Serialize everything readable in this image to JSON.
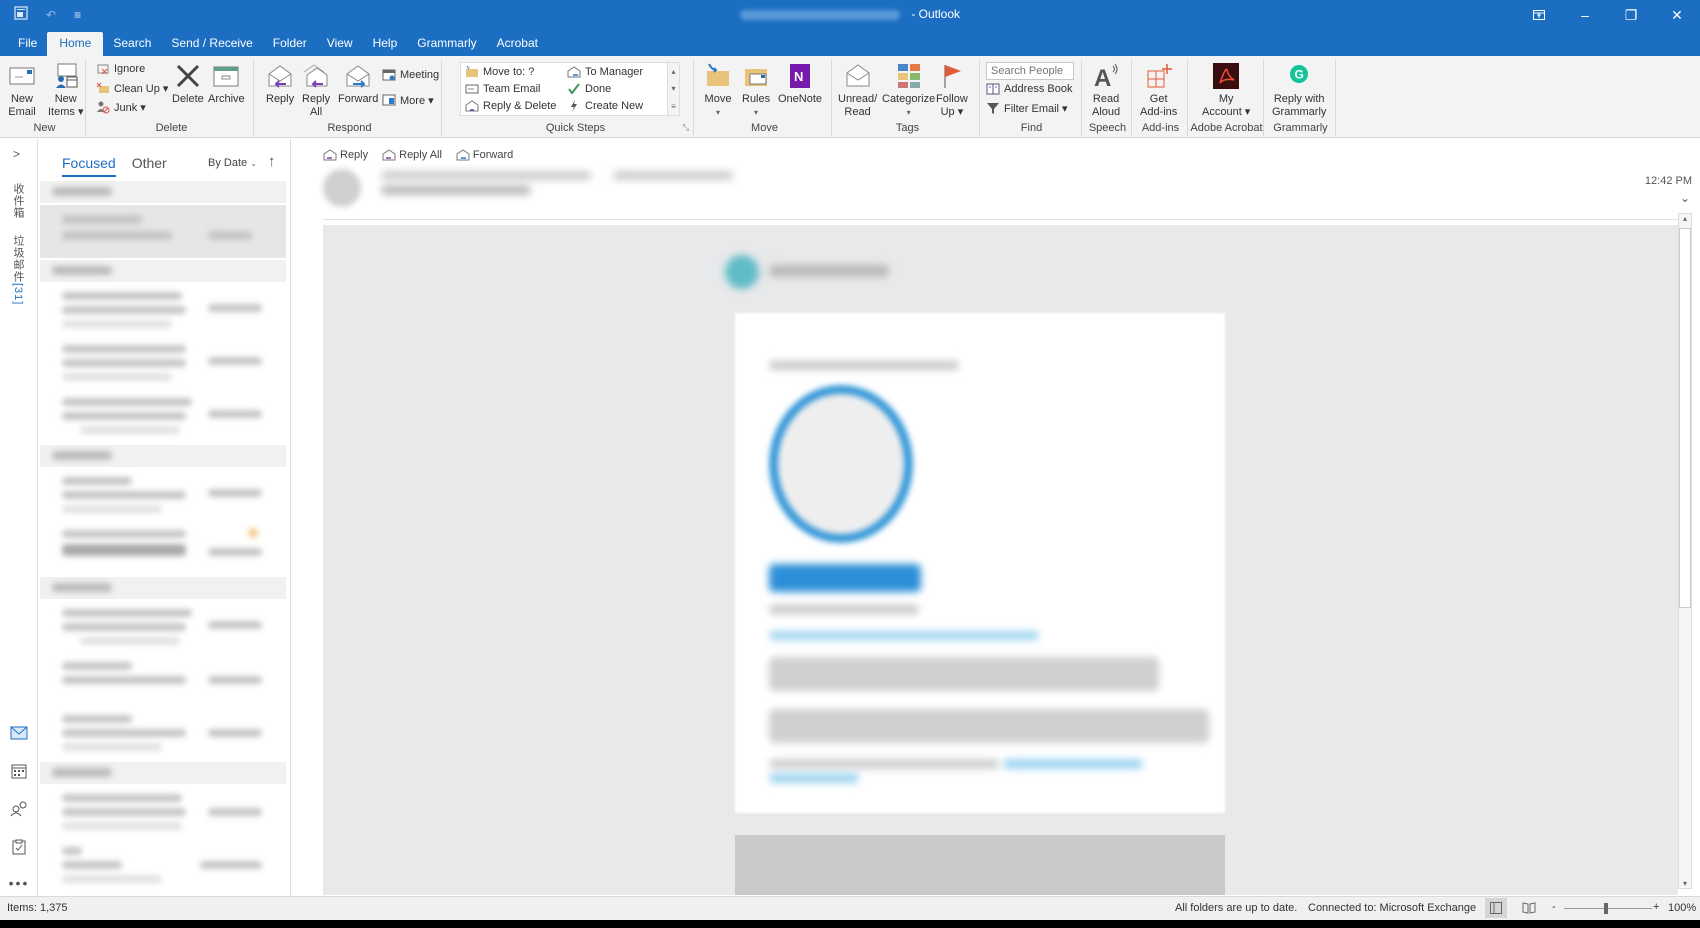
{
  "window": {
    "app_title": "Outlook",
    "title_separator": "-",
    "controls": {
      "ribbon_display": "ribbon-display-icon",
      "minimize": "–",
      "restore": "❐",
      "close": "✕"
    }
  },
  "quick_access": {
    "save_icon": "outlook-icon",
    "undo_icon": "undo-icon",
    "customize_icon": "customize-icon"
  },
  "tabs": [
    {
      "label": "File"
    },
    {
      "label": "Home",
      "active": true
    },
    {
      "label": "Search"
    },
    {
      "label": "Send / Receive"
    },
    {
      "label": "Folder"
    },
    {
      "label": "View"
    },
    {
      "label": "Help"
    },
    {
      "label": "Grammarly"
    },
    {
      "label": "Acrobat"
    }
  ],
  "ribbon": {
    "new": {
      "label": "New",
      "new_email": "New\nEmail",
      "new_email_l1": "New",
      "new_email_l2": "Email",
      "new_items_l1": "New",
      "new_items_l2": "Items ▾"
    },
    "delete": {
      "label": "Delete",
      "ignore": "Ignore",
      "clean_up": "Clean Up ▾",
      "junk": "Junk ▾",
      "delete": "Delete",
      "archive": "Archive"
    },
    "respond": {
      "label": "Respond",
      "reply": "Reply",
      "reply_all_l1": "Reply",
      "reply_all_l2": "All",
      "forward": "Forward",
      "meeting": "Meeting",
      "more": "More ▾"
    },
    "quick_steps": {
      "label": "Quick Steps",
      "items": [
        "Move to: ?",
        "Team Email",
        "Reply & Delete",
        "To Manager",
        "Done",
        "Create New"
      ]
    },
    "move": {
      "label": "Move",
      "move": "Move",
      "rules": "Rules",
      "onenote": "OneNote"
    },
    "tags": {
      "label": "Tags",
      "unread_l1": "Unread/",
      "unread_l2": "Read",
      "categorize": "Categorize",
      "follow_l1": "Follow",
      "follow_l2": "Up ▾"
    },
    "find": {
      "label": "Find",
      "search_people_placeholder": "Search People",
      "address_book": "Address Book",
      "filter_email": "Filter Email ▾"
    },
    "speech": {
      "label": "Speech",
      "read_l1": "Read",
      "read_l2": "Aloud"
    },
    "addins": {
      "label": "Add-ins",
      "get_l1": "Get",
      "get_l2": "Add-ins"
    },
    "acrobat": {
      "label": "Adobe Acrobat",
      "my_l1": "My",
      "my_l2": "Account ▾"
    },
    "grammarly": {
      "label": "Grammarly",
      "reply_l1": "Reply with",
      "reply_l2": "Grammarly"
    }
  },
  "folder_pane": {
    "expand_icon": ">",
    "inbox_label": "收件箱",
    "junk_label": "垃圾邮件",
    "junk_count": "[31]",
    "nav": [
      "mail-icon",
      "calendar-icon",
      "people-icon",
      "tasks-icon",
      "more-icon"
    ]
  },
  "message_list": {
    "tabs": [
      {
        "label": "Focused",
        "active": true
      },
      {
        "label": "Other"
      }
    ],
    "sort_label": "By Date",
    "sort_direction": "↑"
  },
  "reading_pane": {
    "actions": {
      "reply": "Reply",
      "reply_all": "Reply All",
      "forward": "Forward"
    },
    "time": "12:42 PM"
  },
  "status_bar": {
    "items": "Items: 1,375",
    "sync": "All folders are up to date.",
    "connection": "Connected to: Microsoft Exchange",
    "zoom": "100%",
    "zoom_minus": "-",
    "zoom_plus": "+"
  },
  "colors": {
    "accent": "#1b6ec2",
    "ribbon_bg": "#f3f3f3",
    "email_bg": "#e8e9eb",
    "badge_blue": "#3a9ad9"
  }
}
